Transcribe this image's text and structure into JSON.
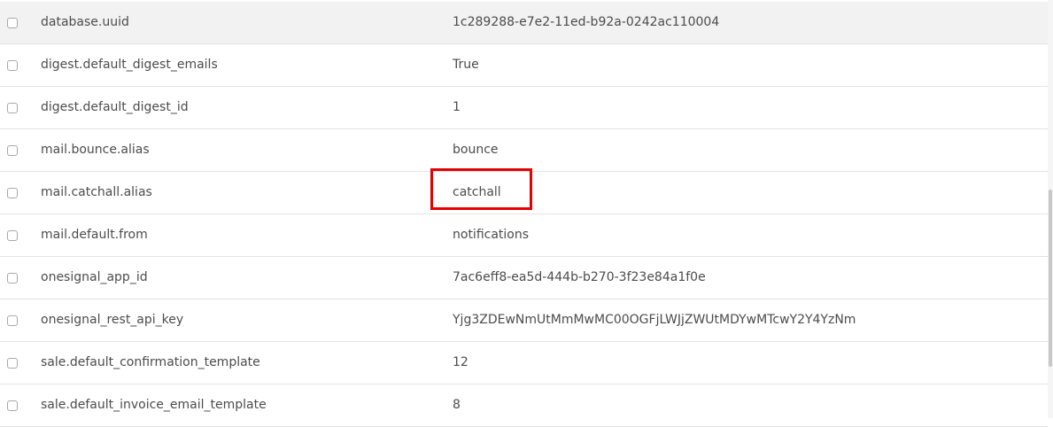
{
  "parameters": [
    {
      "key": "database.uuid",
      "value": "1c289288-e7e2-11ed-b92a-0242ac110004"
    },
    {
      "key": "digest.default_digest_emails",
      "value": "True"
    },
    {
      "key": "digest.default_digest_id",
      "value": "1"
    },
    {
      "key": "mail.bounce.alias",
      "value": "bounce"
    },
    {
      "key": "mail.catchall.alias",
      "value": "catchall"
    },
    {
      "key": "mail.default.from",
      "value": "notifications"
    },
    {
      "key": "onesignal_app_id",
      "value": "7ac6eff8-ea5d-444b-b270-3f23e84a1f0e"
    },
    {
      "key": "onesignal_rest_api_key",
      "value": "Yjg3ZDEwNmUtMmMwMC00OGFjLWJjZWUtMDYwMTcwY2Y4YzNm"
    },
    {
      "key": "sale.default_confirmation_template",
      "value": "12"
    },
    {
      "key": "sale.default_invoice_email_template",
      "value": "8"
    }
  ],
  "colors": {
    "highlight_border": "#e60000",
    "hover_row": "#f2f2f2",
    "text": "#4c4c4c"
  }
}
